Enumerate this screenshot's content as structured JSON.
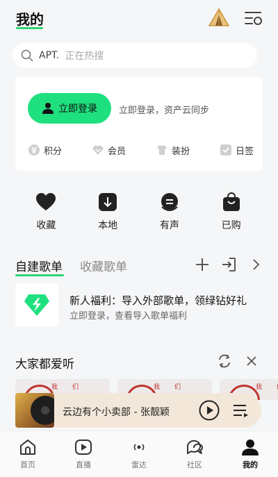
{
  "header": {
    "title": "我的"
  },
  "search": {
    "keyword": "APT.",
    "hint": "正在热搜"
  },
  "login": {
    "button_label": "立即登录",
    "hint": "立即登录，资产云同步",
    "items": [
      {
        "label": "积分",
        "icon": "yen-icon"
      },
      {
        "label": "会员",
        "icon": "diamond-icon"
      },
      {
        "label": "装扮",
        "icon": "shirt-icon"
      },
      {
        "label": "日签",
        "icon": "checkin-icon"
      }
    ]
  },
  "quick_actions": [
    {
      "label": "收藏",
      "icon": "heart-icon"
    },
    {
      "label": "本地",
      "icon": "download-icon"
    },
    {
      "label": "有声",
      "icon": "audiobook-icon"
    },
    {
      "label": "已购",
      "icon": "bag-icon"
    }
  ],
  "playlist_tabs": {
    "active": "自建歌单",
    "other": "收藏歌单"
  },
  "promo": {
    "title": "新人福利：导入外部歌单，领绿钻好礼",
    "subtitle": "立即登录，查看导入歌单福利"
  },
  "recommend": {
    "title": "大家都爱听",
    "covers": [
      {
        "label_a": "我",
        "label_b": "们"
      },
      {
        "label_a": "我",
        "label_b": "们"
      },
      {
        "label_a": "我",
        "label_b": "们"
      }
    ]
  },
  "player": {
    "song": "云边有个小卖部 - 张靓颖"
  },
  "tabbar": [
    {
      "label": "首页",
      "icon": "home-icon",
      "active": false
    },
    {
      "label": "直播",
      "icon": "live-icon",
      "active": false
    },
    {
      "label": "雷达",
      "icon": "radar-icon",
      "active": false
    },
    {
      "label": "社区",
      "icon": "community-icon",
      "active": false
    },
    {
      "label": "我的",
      "icon": "profile-icon",
      "active": true
    }
  ],
  "colors": {
    "accent": "#1ee07e",
    "background": "#f5f6f8",
    "player": "#f3e7da"
  }
}
